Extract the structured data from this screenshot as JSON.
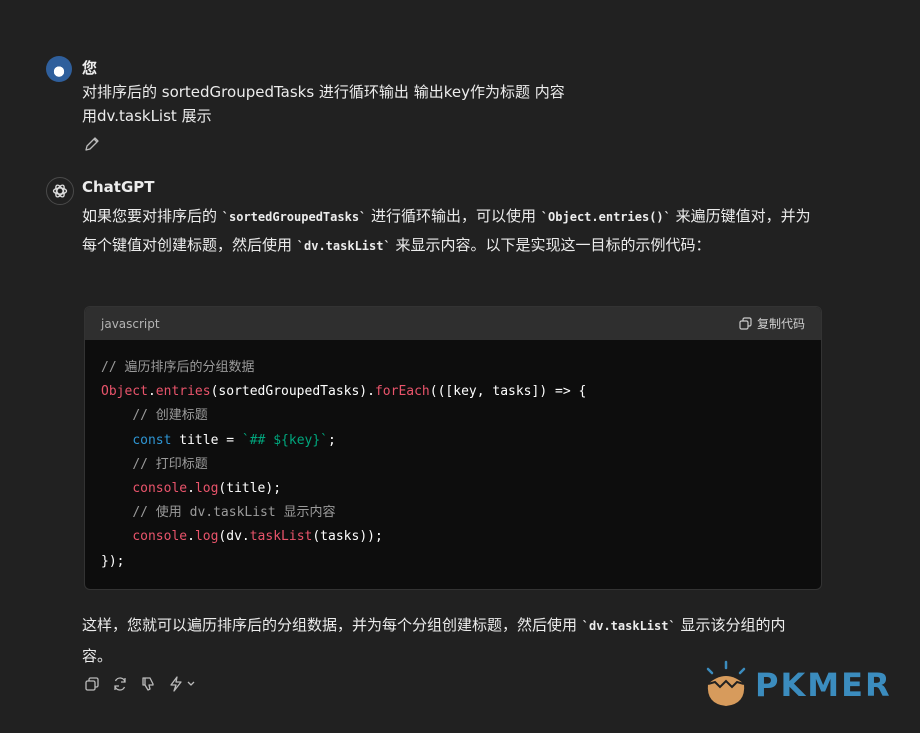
{
  "user": {
    "name": "您",
    "line1": "对排序后的 sortedGroupedTasks  进行循环输出 输出key作为标题 内容",
    "line2": "用dv.taskList 展示"
  },
  "assistant": {
    "name": "ChatGPT",
    "intro_p1": "如果您要对排序后的 ",
    "intro_c1": "`sortedGroupedTasks`",
    "intro_p2": " 进行循环输出，可以使用 ",
    "intro_c2": "`Object.entries()`",
    "intro_p3": " 来遍历键值对，并为每个键值对创建标题，然后使用 ",
    "intro_c3": "`dv.taskList`",
    "intro_p4": " 来显示内容。以下是实现这一目标的示例代码：",
    "code": {
      "language": "javascript",
      "copy_label": "复制代码",
      "lines": {
        "l1": "// 遍历排序后的分组数据",
        "l2_obj": "Object",
        "l2_dot": ".",
        "l2_fn": "entries",
        "l2_mid": "(sortedGroupedTasks).",
        "l2_fe": "forEach",
        "l2_end": "(([key, tasks]) => {",
        "l3": "// 创建标题",
        "l4_kw": "const",
        "l4_mid": " title = ",
        "l4_str": "`## ${key}`",
        "l4_end": ";",
        "l5": "// 打印标题",
        "l6_obj": "console",
        "l6_dot": ".",
        "l6_fn": "log",
        "l6_end": "(title);",
        "l7": "// 使用 dv.taskList 显示内容",
        "l8_obj": "console",
        "l8_dot": ".",
        "l8_fn": "log",
        "l8_mid": "(dv.",
        "l8_fn2": "taskList",
        "l8_end": "(tasks));",
        "l9": "});"
      }
    },
    "outro_p1": "这样，您就可以遍历排序后的分组数据，并为每个分组创建标题，然后使用 ",
    "outro_c1": "`dv.taskList`",
    "outro_p2": " 显示该分组的内容。"
  },
  "watermark": "PKMER",
  "colors": {
    "background": "#212121",
    "code_bg": "#0d0d0d",
    "keyword": "#e9546b",
    "blue": "#2e95d3",
    "string": "#00a67d",
    "brand": "#3b8cbe"
  }
}
